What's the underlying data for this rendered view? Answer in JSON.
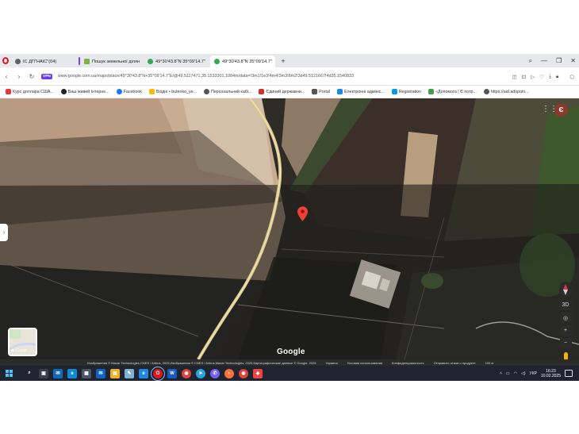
{
  "browser": {
    "tabs": [
      {
        "title": "IC ДП\"НАІС\"(04)",
        "favicon_color": "#5f6368",
        "active": false
      },
      {
        "title": "Пошук земельної ділян",
        "favicon_color": "#7cb342",
        "active": false
      },
      {
        "title": "49°30'43.8\"N 35°09'14.7\"",
        "favicon_color": "#34a853",
        "active": false
      },
      {
        "title": "49°30'43.8\"N 35°09'14.7\"",
        "favicon_color": "#34a853",
        "active": true
      }
    ],
    "new_tab": "+",
    "vpn_label": "VPN",
    "url": "www.google.com.ua/maps/place/49°30'43.8\"N+35°09'14.7\"E/@49.5117471,35.1533301,1084m/data=!3m1!1e3!4m4!3m3!8m2!3d49.5121667!4d35.1540833",
    "bookmarks": [
      {
        "label": "Курс доллара США...",
        "icon_color": "#e53935"
      },
      {
        "label": "Ваш живий Інтерне...",
        "icon_color": "#222222"
      },
      {
        "label": "Facebook",
        "icon_color": "#1877f2"
      },
      {
        "label": "Вхідні • butenko_ye...",
        "icon_color": "#fbbc04"
      },
      {
        "label": "Персональний кабі...",
        "icon_color": "#555555"
      },
      {
        "label": "Єдиний державни...",
        "icon_color": "#d32f2f"
      },
      {
        "label": "Portal",
        "icon_color": "#555555"
      },
      {
        "label": "Електронні адмініс...",
        "icon_color": "#1e88e5"
      },
      {
        "label": "Registration",
        "icon_color": "#039be5"
      },
      {
        "label": "«Допомога | Є потр...",
        "icon_color": "#43a047"
      },
      {
        "label": "https://aid.adopoin...",
        "icon_color": "#555555"
      }
    ]
  },
  "map": {
    "avatar_letter": "Є",
    "layers_label": "Слои",
    "google_logo": "Google",
    "zoom_in": "+",
    "zoom_out": "−",
    "tilt_label": "3D",
    "attribution": [
      "Изображения © Maxar Technologies,CNES / Airbus, 2025,Изображения © CNES / Airbus,Maxar Technologies, 2025,Картографические данные © Google, 2025",
      "Украина",
      "Условия использования",
      "Конфиденциальность",
      "Отправить отзыв о продукте",
      "100 м"
    ]
  },
  "taskbar": {
    "lang": "УКР",
    "time": "16:23",
    "date": "10.02.2025",
    "apps": [
      {
        "name": "search",
        "color": "#1f2430",
        "glyph": "⌕"
      },
      {
        "name": "task-view",
        "color": "#3a3f4b",
        "glyph": "▣"
      },
      {
        "name": "mail",
        "color": "#0f6cbd",
        "glyph": "✉"
      },
      {
        "name": "edge",
        "color": "#0b8bd6",
        "glyph": "e"
      },
      {
        "name": "calculator",
        "color": "#4b5563",
        "glyph": "▦"
      },
      {
        "name": "outlook",
        "color": "#0a66c2",
        "glyph": "✉"
      },
      {
        "name": "explorer",
        "color": "#f2b01e",
        "glyph": "▤"
      },
      {
        "name": "notepad",
        "color": "#7fb3d5",
        "glyph": "✎"
      },
      {
        "name": "ie",
        "color": "#1e88e5",
        "glyph": "e"
      },
      {
        "name": "opera",
        "color": "#e2171f",
        "glyph": "O"
      },
      {
        "name": "word",
        "color": "#185abd",
        "glyph": "W"
      },
      {
        "name": "chrome",
        "color": "#db4437",
        "glyph": "◉"
      },
      {
        "name": "telegram",
        "color": "#2aa3de",
        "glyph": "➤"
      },
      {
        "name": "viber",
        "color": "#7360f2",
        "glyph": "✆"
      },
      {
        "name": "firefox",
        "color": "#ff7139",
        "glyph": "◐"
      },
      {
        "name": "chrome-2",
        "color": "#db4437",
        "glyph": "◉"
      },
      {
        "name": "anydesk",
        "color": "#ef443b",
        "glyph": "◆"
      }
    ]
  }
}
